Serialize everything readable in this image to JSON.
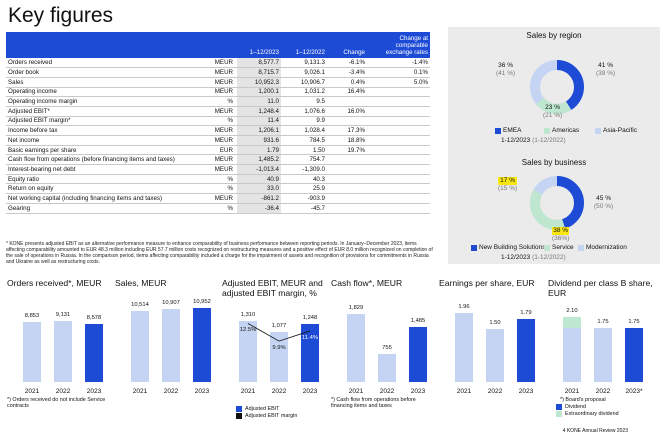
{
  "title": "Key figures",
  "table": {
    "head": {
      "c1": "1–12/2023",
      "c2": "1–12/2022",
      "c3": "Change",
      "c4": "Change at comparable exchange rates"
    },
    "rows": [
      {
        "label": "Orders received",
        "unit": "MEUR",
        "v2023": "8,577.7",
        "v2022": "9,131.3",
        "change": "-6.1%",
        "cer": "-1.4%"
      },
      {
        "label": "Order book",
        "unit": "MEUR",
        "v2023": "8,715.7",
        "v2022": "9,026.1",
        "change": "-3.4%",
        "cer": "0.1%"
      },
      {
        "label": "Sales",
        "unit": "MEUR",
        "v2023": "10,952.3",
        "v2022": "10,906.7",
        "change": "0.4%",
        "cer": "5.0%"
      },
      {
        "label": "Operating income",
        "unit": "MEUR",
        "v2023": "1,200.1",
        "v2022": "1,031.2",
        "change": "16.4%",
        "cer": ""
      },
      {
        "label": "Operating income margin",
        "unit": "%",
        "v2023": "11.0",
        "v2022": "9.5",
        "change": "",
        "cer": ""
      },
      {
        "label": "Adjusted EBIT*",
        "unit": "MEUR",
        "v2023": "1,248.4",
        "v2022": "1,076.6",
        "change": "16.0%",
        "cer": ""
      },
      {
        "label": "Adjusted EBIT margin*",
        "unit": "%",
        "v2023": "11.4",
        "v2022": "9.9",
        "change": "",
        "cer": ""
      },
      {
        "label": "Income before tax",
        "unit": "MEUR",
        "v2023": "1,206.1",
        "v2022": "1,028.4",
        "change": "17.3%",
        "cer": ""
      },
      {
        "label": "Net income",
        "unit": "MEUR",
        "v2023": "931.6",
        "v2022": "784.5",
        "change": "18.8%",
        "cer": ""
      },
      {
        "label": "Basic earnings per share",
        "unit": "EUR",
        "v2023": "1.79",
        "v2022": "1.50",
        "change": "19.7%",
        "cer": ""
      },
      {
        "label": "Cash flow from operations (before financing items and taxes)",
        "unit": "MEUR",
        "v2023": "1,485.2",
        "v2022": "754.7",
        "change": "",
        "cer": ""
      },
      {
        "label": "Interest-bearing net debt",
        "unit": "MEUR",
        "v2023": "-1,013.4",
        "v2022": "-1,309.0",
        "change": "",
        "cer": ""
      },
      {
        "label": "Equity ratio",
        "unit": "%",
        "v2023": "40.9",
        "v2022": "40.3",
        "change": "",
        "cer": ""
      },
      {
        "label": "Return on equity",
        "unit": "%",
        "v2023": "33.0",
        "v2022": "25.9",
        "change": "",
        "cer": ""
      },
      {
        "label": "Net working capital (including financing items and taxes)",
        "unit": "MEUR",
        "v2023": "-861.2",
        "v2022": "-903.9",
        "change": "",
        "cer": ""
      },
      {
        "label": "Gearing",
        "unit": "%",
        "v2023": "-36.4",
        "v2022": "-45.7",
        "change": "",
        "cer": ""
      }
    ]
  },
  "footnote": "* KONE presents adjusted EBIT as an alternative performance measure to enhance comparability of business performance between reporting periods. In January–December 2023, items affecting comparability amounted to EUR 48.3 million including EUR 57.7 million costs recognized on restructuring measures and a positive effect of EUR 8.0 million recognized on completion of the sale of operations in Russia. In the comparison period, items affecting comparability included a charge for the impairment of assets and recognition of provisions for commitments in Russia and Ukraine as well as restructuring costs.",
  "region": {
    "title": "Sales by region",
    "emea": {
      "v": "41 %",
      "prev": "(39 %)"
    },
    "americas": {
      "v": "23 %",
      "prev": "(21 %)"
    },
    "apac": {
      "v": "36 %",
      "prev": "(41 %)"
    },
    "legend": [
      "EMEA",
      "Americas",
      "Asia-Pacific"
    ],
    "period": "1-12/2023",
    "period_prev": "(1-12/2022)",
    "colors": {
      "emea": "#1d4bd6",
      "americas": "#bfe6cf",
      "apac": "#c6d4f3"
    }
  },
  "business": {
    "title": "Sales by business",
    "nbs": {
      "v": "45 %",
      "prev": "(50 %)"
    },
    "service": {
      "v": "38 %",
      "prev": "(36%)"
    },
    "modern": {
      "v": "17 %",
      "prev": "(15 %)"
    },
    "legend": [
      "New Building Solutions",
      "Service",
      "Modernization"
    ],
    "period": "1-12/2023",
    "period_prev": "(1-12/2022)"
  },
  "charts": {
    "orders": {
      "title": "Orders received*, MEUR",
      "note": "*) Orders received do not include Service contracts"
    },
    "sales": {
      "title": "Sales, MEUR"
    },
    "ebit": {
      "title": "Adjusted EBIT, MEUR and adjusted EBIT margin, %",
      "legend": [
        "Adjusted EBIT",
        "Adjusted EBIT margin"
      ]
    },
    "cash": {
      "title": "Cash flow*, MEUR",
      "note": "*) Cash flow from operations before financing items and taxes"
    },
    "eps": {
      "title": "Earnings per share, EUR"
    },
    "div": {
      "title": "Dividend per class B share, EUR",
      "note": "*) Board's proposal",
      "legend": [
        "Dividend",
        "Extraordinary dividend"
      ]
    }
  },
  "chart_data": [
    {
      "type": "bar",
      "title": "Orders received*, MEUR",
      "categories": [
        "2021",
        "2022",
        "2023"
      ],
      "values": [
        8853,
        9131,
        8578
      ]
    },
    {
      "type": "bar",
      "title": "Sales, MEUR",
      "categories": [
        "2021",
        "2022",
        "2023"
      ],
      "values": [
        10514,
        10907,
        10952
      ]
    },
    {
      "type": "bar",
      "title": "Adjusted EBIT, MEUR and adjusted EBIT margin, %",
      "categories": [
        "2021",
        "2022",
        "2023"
      ],
      "series": [
        {
          "name": "Adjusted EBIT",
          "values": [
            1310,
            1077,
            1248
          ]
        },
        {
          "name": "Adjusted EBIT margin",
          "values": [
            12.5,
            9.9,
            11.4
          ]
        }
      ]
    },
    {
      "type": "bar",
      "title": "Cash flow*, MEUR",
      "categories": [
        "2021",
        "2022",
        "2023"
      ],
      "values": [
        1829,
        755,
        1485
      ]
    },
    {
      "type": "bar",
      "title": "Earnings per share, EUR",
      "categories": [
        "2021",
        "2022",
        "2023"
      ],
      "values": [
        1.96,
        1.5,
        1.79
      ]
    },
    {
      "type": "bar",
      "title": "Dividend per class B share, EUR",
      "categories": [
        "2021",
        "2022",
        "2023*"
      ],
      "series": [
        {
          "name": "Dividend",
          "values": [
            1.75,
            1.75,
            1.75
          ]
        },
        {
          "name": "Extraordinary dividend",
          "values": [
            0.35,
            0,
            0
          ]
        }
      ],
      "labels": [
        "2.10",
        "1.75",
        "1.75"
      ]
    }
  ],
  "page": "4     KONE Annual Review 2023"
}
